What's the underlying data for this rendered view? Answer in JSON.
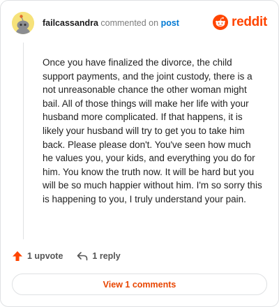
{
  "header": {
    "username": "failcassandra",
    "verb": "commented on",
    "target": "post"
  },
  "brand": {
    "name": "reddit",
    "icon": "reddit-logo-icon",
    "color": "#ff4500"
  },
  "comment": {
    "text": "Once you have finalized the divorce, the child support payments, and the joint custody, there is a not unreasonable chance the other woman might bail. All of those things will make her life with your husband more complicated. If that happens, it is likely your husband will try to get you to take him back. Please please don't. You've seen how much he values you, your kids, and everything you do for him. You know the truth now. It will be hard but you will be so much happier without him. I'm so sorry this is happening to you, I truly understand your pain."
  },
  "actions": {
    "upvote_label": "1 upvote",
    "upvote_icon": "upvote-arrow-icon",
    "reply_label": "1 reply",
    "reply_icon": "reply-arrow-icon"
  },
  "footer": {
    "view_comments_label": "View 1 comments"
  },
  "colors": {
    "accent": "#ff4500",
    "link": "#0079d3",
    "avatar_bg": "#f6e27a"
  }
}
